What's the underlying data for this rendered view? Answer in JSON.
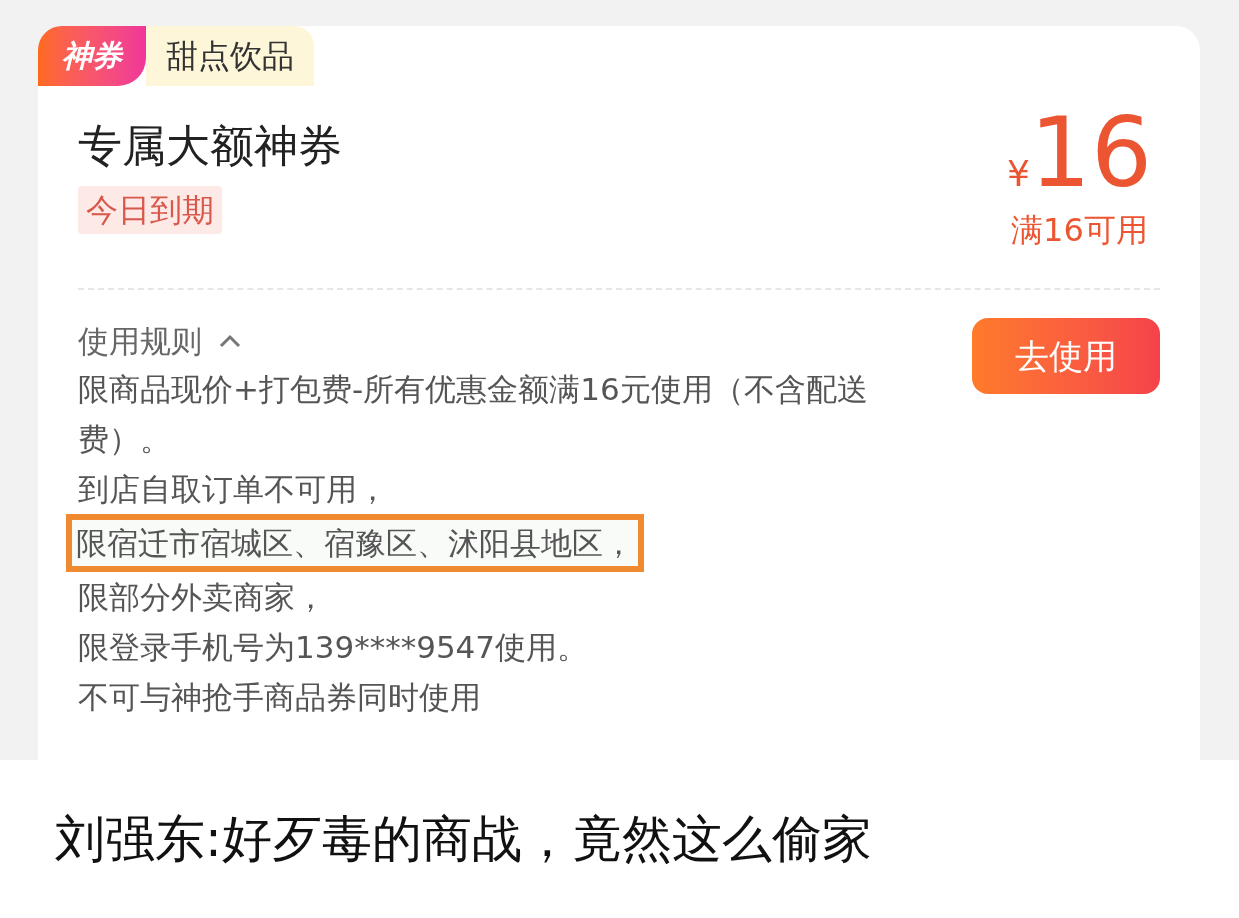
{
  "coupon": {
    "badge": "神券",
    "category": "甜点饮品",
    "title": "专属大额神券",
    "expiry": "今日到期",
    "currency": "¥",
    "amount": "16",
    "condition": "满16可用",
    "rules_label": "使用规则",
    "rules_expanded": true,
    "use_button": "去使用",
    "rules": [
      {
        "text": "限商品现价+打包费-所有优惠金额满16元使用（不含配送费）。",
        "highlighted": false
      },
      {
        "text": "到店自取订单不可用，",
        "highlighted": false
      },
      {
        "text": "限宿迁市宿城区、宿豫区、沭阳县地区，",
        "highlighted": true
      },
      {
        "text": "限部分外卖商家，",
        "highlighted": false
      },
      {
        "text": "限登录手机号为139****9547使用。",
        "highlighted": false
      },
      {
        "text": "不可与神抢手商品券同时使用",
        "highlighted": false
      }
    ]
  },
  "caption": "刘强东:好歹毒的商战，竟然这么偷家"
}
